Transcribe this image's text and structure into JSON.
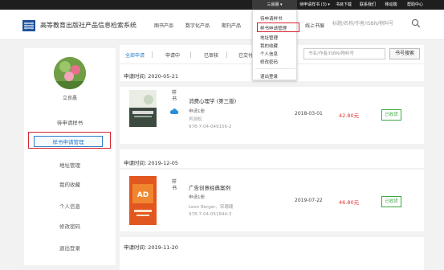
{
  "topbar": {
    "user_label": "三良晨 ▾",
    "items": [
      "待申请样书 (3) ▾",
      "书目下载",
      "联系我们",
      "移动端",
      "帮助中心"
    ]
  },
  "header": {
    "site_title": "高等教育出版社产品信息检索系统",
    "nav": [
      "图书产品",
      "数字化产品",
      "期刊产品",
      "线上书展"
    ],
    "search_placeholder": "标题/名称/作者/ISBN/物料号"
  },
  "dropdown": {
    "items": [
      "待申请样书",
      "样书申请管理",
      "地址管理",
      "我的收藏",
      "个人信息",
      "修改密码",
      "退出登录"
    ]
  },
  "sidebar": {
    "username": "立良晨",
    "items": [
      "待申请样书",
      "样书申请管理",
      "地址管理",
      "我的收藏",
      "个人信息",
      "修改密码",
      "退出登录"
    ]
  },
  "main": {
    "tabs": [
      "全部申请",
      "申请中",
      "已审核",
      "已交付"
    ],
    "search_placeholder": "书名/作者/ISBN/物料号",
    "search_button": "书号搜索",
    "sections": [
      {
        "date_label": "申请时间: 2020-05-21",
        "book": {
          "badge": "样书",
          "title": "消费心理学 (第三版)",
          "qty": "申请1册",
          "author": "肖涧松",
          "isbn": "978-7-04-049156-2",
          "pub_date": "2018-03-01",
          "price": "42.80元",
          "status": "已收货"
        }
      },
      {
        "date_label": "申请时间: 2019-12-05",
        "book": {
          "badge": "样书",
          "title": "广告创意经典案例",
          "qty": "申请1册",
          "author": "Leon Berger、宋珊珊",
          "isbn": "978-7-04-051844-3",
          "pub_date": "2019-07-22",
          "price": "46.80元",
          "status": "已收货"
        }
      },
      {
        "date_label": "申请时间: 2019-11-20"
      }
    ]
  },
  "colors": {
    "accent": "#2a7ec8",
    "highlight_box": "#d8262f",
    "price": "#e03030",
    "status": "#3aa840",
    "topbar": "#1e1e1e"
  }
}
